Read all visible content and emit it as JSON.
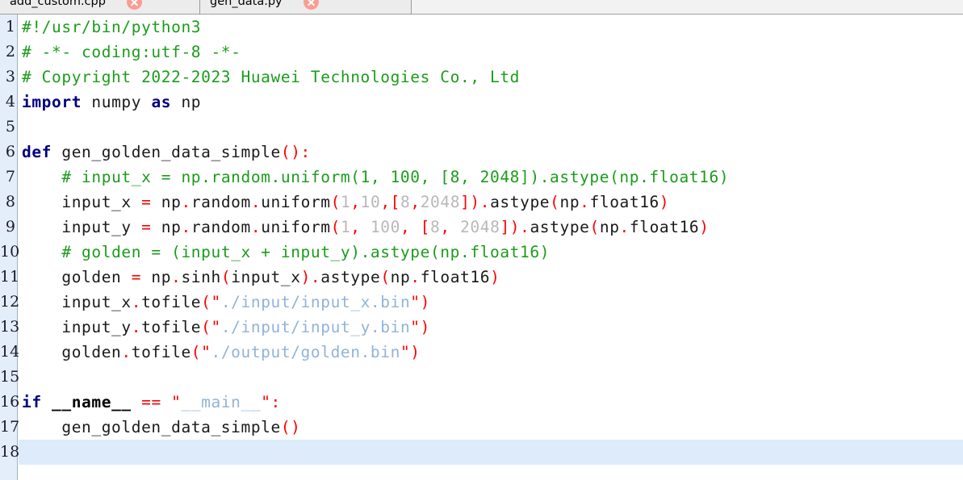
{
  "window": {
    "app": "code-editor",
    "colors": {
      "comment": "#1b9c1b",
      "keyword": "#00007f",
      "punctuation": "#ff0000",
      "string": "#90b4d8",
      "number": "#b8b8b8",
      "plain": "#1a1a1a",
      "gutter_bg": "#e4eefb",
      "current_line_bg": "#ddebfa",
      "tab_bg": "#ececec",
      "tab_close": "#f99d92",
      "editor_bg": "#ffffff"
    }
  },
  "tabs": [
    {
      "label": "add_custom.cpp",
      "close_icon": "close-icon",
      "active": false
    },
    {
      "label": "gen_data.py",
      "close_icon": "close-icon",
      "active": true
    }
  ],
  "editor": {
    "language": "python",
    "current_line": 18,
    "total_lines": 18,
    "line_numbers": [
      "1",
      "2",
      "3",
      "4",
      "5",
      "6",
      "7",
      "8",
      "9",
      "10",
      "11",
      "12",
      "13",
      "14",
      "15",
      "16",
      "17",
      "18"
    ],
    "plain_text": [
      "#!/usr/bin/python3",
      "# -*- coding:utf-8 -*-",
      "# Copyright 2022-2023 Huawei Technologies Co., Ltd",
      "import numpy as np",
      "",
      "def gen_golden_data_simple():",
      "    # input_x = np.random.uniform(1, 100, [8, 2048]).astype(np.float16)",
      "    input_x = np.random.uniform(1,10,[8,2048]).astype(np.float16)",
      "    input_y = np.random.uniform(1, 100, [8, 2048]).astype(np.float16)",
      "    # golden = (input_x + input_y).astype(np.float16)",
      "    golden = np.sinh(input_x).astype(np.float16)",
      "    input_x.tofile(\"./input/input_x.bin\")",
      "    input_y.tofile(\"./input/input_y.bin\")",
      "    golden.tofile(\"./output/golden.bin\")",
      "",
      "if __name__ == \"__main__\":",
      "    gen_golden_data_simple()",
      ""
    ],
    "lines": [
      {
        "n": "1",
        "tokens": [
          {
            "t": "#!/usr/bin/python3",
            "c": "com"
          }
        ]
      },
      {
        "n": "2",
        "tokens": [
          {
            "t": "# -*- coding:utf-8 -*-",
            "c": "com"
          }
        ]
      },
      {
        "n": "3",
        "tokens": [
          {
            "t": "# Copyright 2022-2023 Huawei Technologies Co., Ltd",
            "c": "com"
          }
        ]
      },
      {
        "n": "4",
        "tokens": [
          {
            "t": "import",
            "c": "kw"
          },
          {
            "t": " numpy ",
            "c": "pln"
          },
          {
            "t": "as",
            "c": "kw"
          },
          {
            "t": " np",
            "c": "pln"
          }
        ]
      },
      {
        "n": "5",
        "tokens": []
      },
      {
        "n": "6",
        "tokens": [
          {
            "t": "def",
            "c": "kw"
          },
          {
            "t": " gen_golden_data_simple",
            "c": "pln"
          },
          {
            "t": "():",
            "c": "pun"
          }
        ]
      },
      {
        "n": "7",
        "tokens": [
          {
            "t": "    ",
            "c": "pln"
          },
          {
            "t": "# input_x = np.random.uniform(1, 100, [8, 2048]).astype(np.float16)",
            "c": "com"
          }
        ]
      },
      {
        "n": "8",
        "tokens": [
          {
            "t": "    input_x ",
            "c": "pln"
          },
          {
            "t": "=",
            "c": "pun"
          },
          {
            "t": " np",
            "c": "pln"
          },
          {
            "t": ".",
            "c": "pun"
          },
          {
            "t": "random",
            "c": "pln"
          },
          {
            "t": ".",
            "c": "pun"
          },
          {
            "t": "uniform",
            "c": "pln"
          },
          {
            "t": "(",
            "c": "pun"
          },
          {
            "t": "1",
            "c": "num"
          },
          {
            "t": ",",
            "c": "pun"
          },
          {
            "t": "10",
            "c": "num"
          },
          {
            "t": ",[",
            "c": "pun"
          },
          {
            "t": "8",
            "c": "num"
          },
          {
            "t": ",",
            "c": "pun"
          },
          {
            "t": "2048",
            "c": "num"
          },
          {
            "t": "])",
            "c": "pun"
          },
          {
            "t": ".",
            "c": "pun"
          },
          {
            "t": "astype",
            "c": "pln"
          },
          {
            "t": "(",
            "c": "pun"
          },
          {
            "t": "np",
            "c": "pln"
          },
          {
            "t": ".",
            "c": "pun"
          },
          {
            "t": "float16",
            "c": "pln"
          },
          {
            "t": ")",
            "c": "pun"
          }
        ]
      },
      {
        "n": "9",
        "tokens": [
          {
            "t": "    input_y ",
            "c": "pln"
          },
          {
            "t": "=",
            "c": "pun"
          },
          {
            "t": " np",
            "c": "pln"
          },
          {
            "t": ".",
            "c": "pun"
          },
          {
            "t": "random",
            "c": "pln"
          },
          {
            "t": ".",
            "c": "pun"
          },
          {
            "t": "uniform",
            "c": "pln"
          },
          {
            "t": "(",
            "c": "pun"
          },
          {
            "t": "1",
            "c": "num"
          },
          {
            "t": ", ",
            "c": "pun"
          },
          {
            "t": "100",
            "c": "num"
          },
          {
            "t": ", [",
            "c": "pun"
          },
          {
            "t": "8",
            "c": "num"
          },
          {
            "t": ", ",
            "c": "pun"
          },
          {
            "t": "2048",
            "c": "num"
          },
          {
            "t": "])",
            "c": "pun"
          },
          {
            "t": ".",
            "c": "pun"
          },
          {
            "t": "astype",
            "c": "pln"
          },
          {
            "t": "(",
            "c": "pun"
          },
          {
            "t": "np",
            "c": "pln"
          },
          {
            "t": ".",
            "c": "pun"
          },
          {
            "t": "float16",
            "c": "pln"
          },
          {
            "t": ")",
            "c": "pun"
          }
        ]
      },
      {
        "n": "10",
        "tokens": [
          {
            "t": "    ",
            "c": "pln"
          },
          {
            "t": "# golden = (input_x + input_y).astype(np.float16)",
            "c": "com"
          }
        ]
      },
      {
        "n": "11",
        "tokens": [
          {
            "t": "    golden ",
            "c": "pln"
          },
          {
            "t": "=",
            "c": "pun"
          },
          {
            "t": " np",
            "c": "pln"
          },
          {
            "t": ".",
            "c": "pun"
          },
          {
            "t": "sinh",
            "c": "pln"
          },
          {
            "t": "(",
            "c": "pun"
          },
          {
            "t": "input_x",
            "c": "pln"
          },
          {
            "t": ")",
            "c": "pun"
          },
          {
            "t": ".",
            "c": "pun"
          },
          {
            "t": "astype",
            "c": "pln"
          },
          {
            "t": "(",
            "c": "pun"
          },
          {
            "t": "np",
            "c": "pln"
          },
          {
            "t": ".",
            "c": "pun"
          },
          {
            "t": "float16",
            "c": "pln"
          },
          {
            "t": ")",
            "c": "pun"
          }
        ]
      },
      {
        "n": "12",
        "tokens": [
          {
            "t": "    input_x",
            "c": "pln"
          },
          {
            "t": ".",
            "c": "pun"
          },
          {
            "t": "tofile",
            "c": "pln"
          },
          {
            "t": "(\"",
            "c": "pun"
          },
          {
            "t": "./input/input_x.bin",
            "c": "str"
          },
          {
            "t": "\")",
            "c": "pun"
          }
        ]
      },
      {
        "n": "13",
        "tokens": [
          {
            "t": "    input_y",
            "c": "pln"
          },
          {
            "t": ".",
            "c": "pun"
          },
          {
            "t": "tofile",
            "c": "pln"
          },
          {
            "t": "(\"",
            "c": "pun"
          },
          {
            "t": "./input/input_y.bin",
            "c": "str"
          },
          {
            "t": "\")",
            "c": "pun"
          }
        ]
      },
      {
        "n": "14",
        "tokens": [
          {
            "t": "    golden",
            "c": "pln"
          },
          {
            "t": ".",
            "c": "pun"
          },
          {
            "t": "tofile",
            "c": "pln"
          },
          {
            "t": "(\"",
            "c": "pun"
          },
          {
            "t": "./output/golden.bin",
            "c": "str"
          },
          {
            "t": "\")",
            "c": "pun"
          }
        ]
      },
      {
        "n": "15",
        "tokens": []
      },
      {
        "n": "16",
        "tokens": [
          {
            "t": "if",
            "c": "kw"
          },
          {
            "t": " ",
            "c": "pln"
          },
          {
            "t": "__name__",
            "c": "nam"
          },
          {
            "t": " ",
            "c": "pln"
          },
          {
            "t": "==",
            "c": "pun"
          },
          {
            "t": " ",
            "c": "pln"
          },
          {
            "t": "\"",
            "c": "pun"
          },
          {
            "t": "__main__",
            "c": "str"
          },
          {
            "t": "\":",
            "c": "pun"
          }
        ]
      },
      {
        "n": "17",
        "tokens": [
          {
            "t": "    gen_golden_data_simple",
            "c": "pln"
          },
          {
            "t": "()",
            "c": "pun"
          }
        ]
      },
      {
        "n": "18",
        "tokens": [],
        "current": true
      }
    ]
  }
}
